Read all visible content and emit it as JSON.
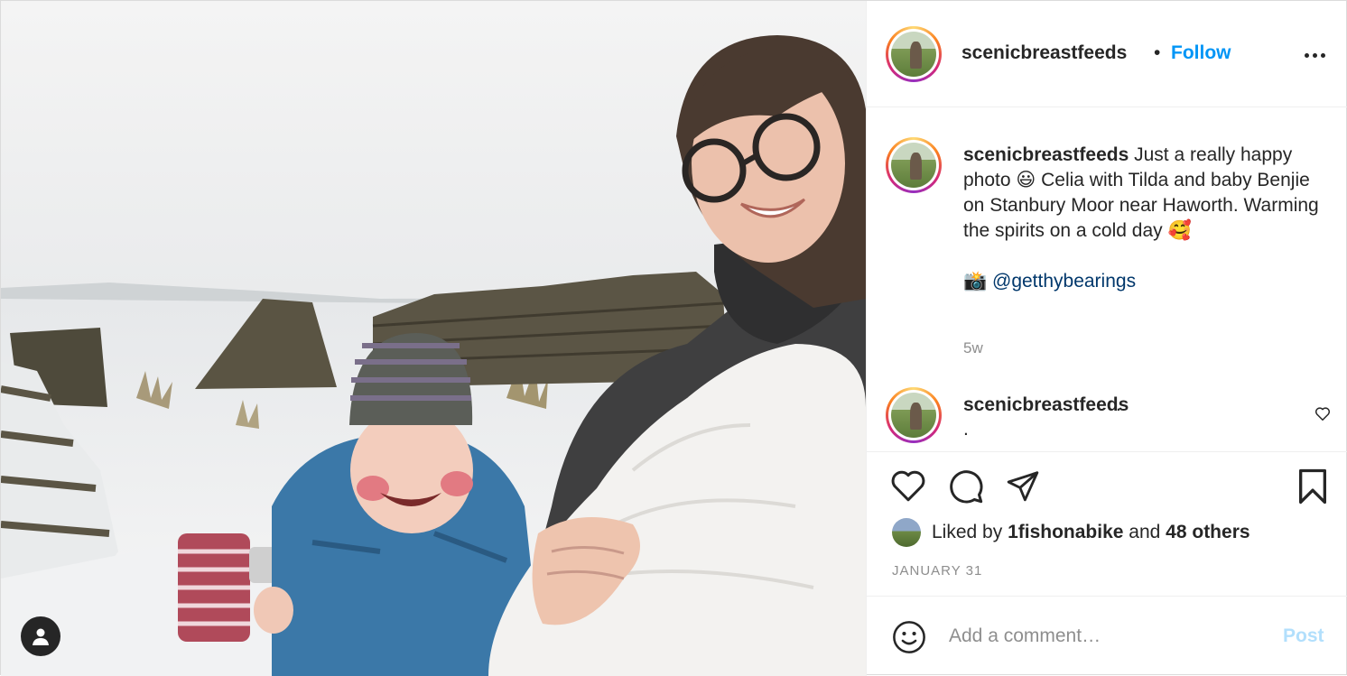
{
  "header": {
    "username": "scenicbreastfeeds",
    "separator": "•",
    "follow_label": "Follow",
    "more_icon": "more-options-icon"
  },
  "caption": {
    "username": "scenicbreastfeeds",
    "line1": "Just a really happy photo 😃 Celia with Tilda and baby Benjie on Stanbury Moor near Haworth. Warming the spirits on a cold day 🥰",
    "camera": "📸",
    "mention": "@getthybearings",
    "time": "5w"
  },
  "comment": {
    "username": "scenicbreastfeeds",
    "text": ".",
    "text2": "."
  },
  "likes": {
    "prefix": "Liked by",
    "user": "1fishonabike",
    "middle": "and",
    "others": "48 others"
  },
  "date": "JANUARY 31",
  "add_comment": {
    "placeholder": "Add a comment…",
    "post_label": "Post"
  },
  "colors": {
    "follow": "#0095f6",
    "mention": "#00376b",
    "post_disabled": "#b2dffc",
    "muted": "#8e8e8e"
  }
}
